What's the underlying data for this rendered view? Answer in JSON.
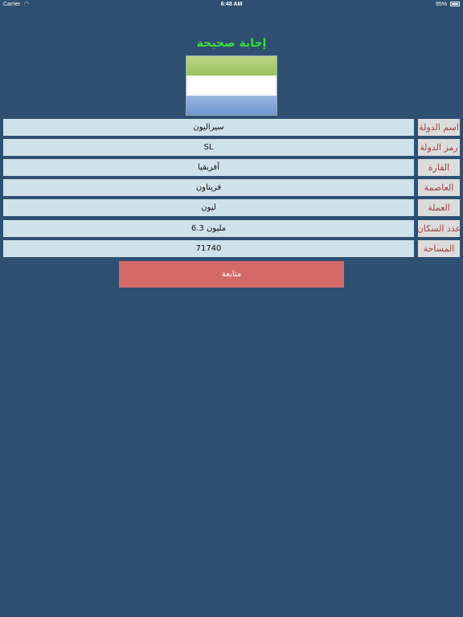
{
  "status_bar": {
    "carrier": "Carrier",
    "time": "6:48 AM",
    "battery": "95%"
  },
  "result": {
    "message": "إجابة صحيحة"
  },
  "flag": {
    "colors": [
      "#9cc25e",
      "#ffffff",
      "#6d96cf"
    ]
  },
  "fields": [
    {
      "label": "اسم الدولة",
      "value": "سيراليون"
    },
    {
      "label": "رمز الدولة",
      "value": "SL"
    },
    {
      "label": "القارة",
      "value": "أفريقيا"
    },
    {
      "label": "العاصمة",
      "value": "فريتاون"
    },
    {
      "label": "العملة",
      "value": "ليون"
    },
    {
      "label": "عدد السكان",
      "value": "6.3 مليون"
    },
    {
      "label": "المساحة",
      "value": "71740"
    }
  ],
  "actions": {
    "continue_label": "متابعة"
  }
}
